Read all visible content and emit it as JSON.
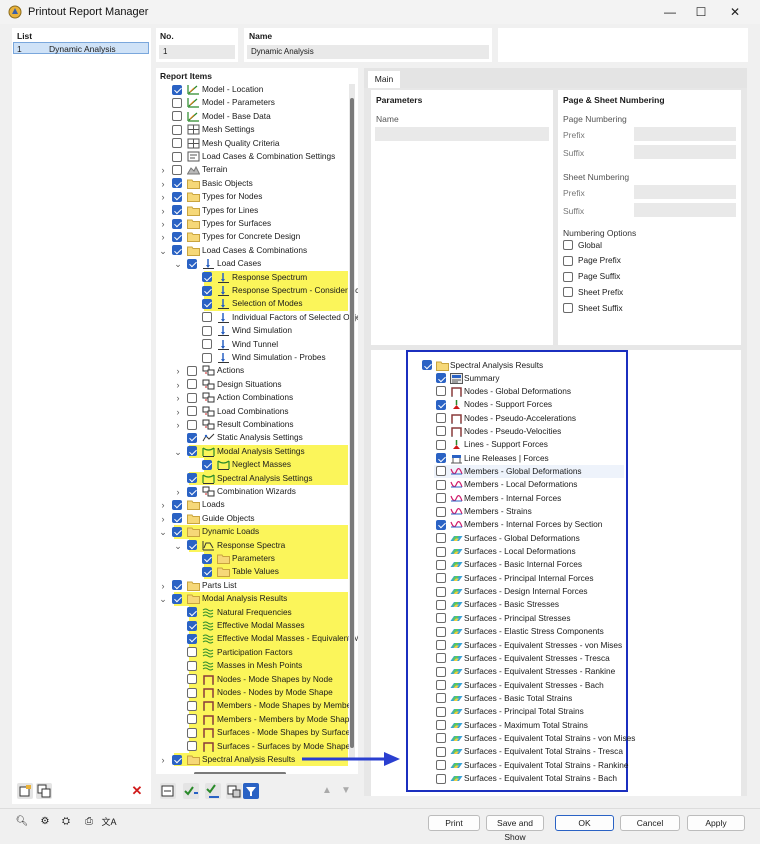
{
  "window": {
    "title": "Printout Report Manager",
    "minimize": "—",
    "maximize": "☐",
    "close": "✕"
  },
  "list": {
    "header": "List",
    "items": [
      {
        "no": "1",
        "name": "Dynamic Analysis"
      }
    ]
  },
  "no_field": {
    "label": "No.",
    "value": "1"
  },
  "name_field": {
    "label": "Name",
    "value": "Dynamic Analysis"
  },
  "report_items": {
    "header": "Report Items",
    "items": [
      {
        "label": "Model - Location",
        "level": 0,
        "checked": true,
        "expander": "",
        "icon": "model-icon",
        "highlight": false
      },
      {
        "label": "Model - Parameters",
        "level": 0,
        "checked": false,
        "expander": "",
        "icon": "model-icon",
        "highlight": false
      },
      {
        "label": "Model - Base Data",
        "level": 0,
        "checked": false,
        "expander": "",
        "icon": "model-icon",
        "highlight": false
      },
      {
        "label": "Mesh Settings",
        "level": 0,
        "checked": false,
        "expander": "",
        "icon": "mesh-icon",
        "highlight": false
      },
      {
        "label": "Mesh Quality Criteria",
        "level": 0,
        "checked": false,
        "expander": "",
        "icon": "mesh-icon",
        "highlight": false
      },
      {
        "label": "Load Cases & Combination Settings",
        "level": 0,
        "checked": false,
        "expander": "",
        "icon": "settings-icon",
        "highlight": false
      },
      {
        "label": "Terrain",
        "level": 0,
        "checked": false,
        "expander": "›",
        "icon": "terrain-icon",
        "highlight": false
      },
      {
        "label": "Basic Objects",
        "level": 0,
        "checked": true,
        "expander": "›",
        "icon": "folder-icon",
        "highlight": false
      },
      {
        "label": "Types for Nodes",
        "level": 0,
        "checked": true,
        "expander": "›",
        "icon": "folder-icon",
        "highlight": false
      },
      {
        "label": "Types for Lines",
        "level": 0,
        "checked": true,
        "expander": "›",
        "icon": "folder-icon",
        "highlight": false
      },
      {
        "label": "Types for Surfaces",
        "level": 0,
        "checked": true,
        "expander": "›",
        "icon": "folder-icon",
        "highlight": false
      },
      {
        "label": "Types for Concrete Design",
        "level": 0,
        "checked": true,
        "expander": "›",
        "icon": "folder-icon",
        "highlight": false
      },
      {
        "label": "Load Cases & Combinations",
        "level": 0,
        "checked": true,
        "expander": "⌄",
        "icon": "folder-icon",
        "highlight": false
      },
      {
        "label": "Load Cases",
        "level": 1,
        "checked": true,
        "expander": "⌄",
        "icon": "load-case-icon",
        "highlight": false
      },
      {
        "label": "Response Spectrum",
        "level": 2,
        "checked": true,
        "expander": "",
        "icon": "load-case-icon",
        "highlight": true
      },
      {
        "label": "Response Spectrum - Consider Ac",
        "level": 2,
        "checked": true,
        "expander": "",
        "icon": "load-case-icon",
        "highlight": true
      },
      {
        "label": "Selection of Modes",
        "level": 2,
        "checked": true,
        "expander": "",
        "icon": "load-case-icon",
        "highlight": true
      },
      {
        "label": "Individual Factors of Selected Obje",
        "level": 2,
        "checked": false,
        "expander": "",
        "icon": "load-case-icon",
        "highlight": false
      },
      {
        "label": "Wind Simulation",
        "level": 2,
        "checked": false,
        "expander": "",
        "icon": "load-case-icon",
        "highlight": false
      },
      {
        "label": "Wind Tunnel",
        "level": 2,
        "checked": false,
        "expander": "",
        "icon": "load-case-icon",
        "highlight": false
      },
      {
        "label": "Wind Simulation - Probes",
        "level": 2,
        "checked": false,
        "expander": "",
        "icon": "load-case-icon",
        "highlight": false
      },
      {
        "label": "Actions",
        "level": 1,
        "checked": false,
        "expander": "›",
        "icon": "action-icon",
        "highlight": false
      },
      {
        "label": "Design Situations",
        "level": 1,
        "checked": false,
        "expander": "›",
        "icon": "action-icon",
        "highlight": false
      },
      {
        "label": "Action Combinations",
        "level": 1,
        "checked": false,
        "expander": "›",
        "icon": "action-icon",
        "highlight": false
      },
      {
        "label": "Load Combinations",
        "level": 1,
        "checked": false,
        "expander": "›",
        "icon": "action-icon",
        "highlight": false
      },
      {
        "label": "Result Combinations",
        "level": 1,
        "checked": false,
        "expander": "›",
        "icon": "action-icon",
        "highlight": false
      },
      {
        "label": "Static Analysis Settings",
        "level": 1,
        "checked": true,
        "expander": "",
        "icon": "analysis-icon",
        "highlight": false
      },
      {
        "label": "Modal Analysis Settings",
        "level": 1,
        "checked": true,
        "expander": "⌄",
        "icon": "modal-icon",
        "highlight": true
      },
      {
        "label": "Neglect Masses",
        "level": 2,
        "checked": true,
        "expander": "",
        "icon": "modal-icon",
        "highlight": true
      },
      {
        "label": "Spectral Analysis Settings",
        "level": 1,
        "checked": true,
        "expander": "",
        "icon": "modal-icon",
        "highlight": true
      },
      {
        "label": "Combination Wizards",
        "level": 1,
        "checked": true,
        "expander": "›",
        "icon": "action-icon",
        "highlight": false
      },
      {
        "label": "Loads",
        "level": 0,
        "checked": true,
        "expander": "›",
        "icon": "folder-icon",
        "highlight": false
      },
      {
        "label": "Guide Objects",
        "level": 0,
        "checked": true,
        "expander": "›",
        "icon": "folder-icon",
        "highlight": false
      },
      {
        "label": "Dynamic Loads",
        "level": 0,
        "checked": true,
        "expander": "⌄",
        "icon": "folder-icon",
        "highlight": true
      },
      {
        "label": "Response Spectra",
        "level": 1,
        "checked": true,
        "expander": "⌄",
        "icon": "spectrum-icon",
        "highlight": true
      },
      {
        "label": "Parameters",
        "level": 2,
        "checked": true,
        "expander": "",
        "icon": "folder-icon",
        "highlight": true
      },
      {
        "label": "Table Values",
        "level": 2,
        "checked": true,
        "expander": "",
        "icon": "folder-icon",
        "highlight": true
      },
      {
        "label": "Parts List",
        "level": 0,
        "checked": true,
        "expander": "›",
        "icon": "folder-icon",
        "highlight": false
      },
      {
        "label": "Modal Analysis Results",
        "level": 0,
        "checked": true,
        "expander": "⌄",
        "icon": "folder-icon",
        "highlight": true
      },
      {
        "label": "Natural Frequencies",
        "level": 1,
        "checked": true,
        "expander": "",
        "icon": "wave-icon",
        "highlight": true
      },
      {
        "label": "Effective Modal Masses",
        "level": 1,
        "checked": true,
        "expander": "",
        "icon": "wave-icon",
        "highlight": true
      },
      {
        "label": "Effective Modal Masses - Equivalent M",
        "level": 1,
        "checked": true,
        "expander": "",
        "icon": "wave-icon",
        "highlight": true
      },
      {
        "label": "Participation Factors",
        "level": 1,
        "checked": false,
        "expander": "",
        "icon": "wave-icon",
        "highlight": true
      },
      {
        "label": "Masses in Mesh Points",
        "level": 1,
        "checked": false,
        "expander": "",
        "icon": "wave-icon",
        "highlight": true
      },
      {
        "label": "Nodes - Mode Shapes by Node",
        "level": 1,
        "checked": false,
        "expander": "",
        "icon": "node-icon",
        "highlight": true
      },
      {
        "label": "Nodes - Nodes by Mode Shape",
        "level": 1,
        "checked": false,
        "expander": "",
        "icon": "node-icon",
        "highlight": true
      },
      {
        "label": "Members - Mode Shapes by Member",
        "level": 1,
        "checked": false,
        "expander": "",
        "icon": "node-icon",
        "highlight": true
      },
      {
        "label": "Members - Members by Mode Shape",
        "level": 1,
        "checked": false,
        "expander": "",
        "icon": "node-icon",
        "highlight": true
      },
      {
        "label": "Surfaces - Mode Shapes by Surface",
        "level": 1,
        "checked": false,
        "expander": "",
        "icon": "node-icon",
        "highlight": true
      },
      {
        "label": "Surfaces - Surfaces by Mode Shape",
        "level": 1,
        "checked": false,
        "expander": "",
        "icon": "node-icon",
        "highlight": true
      },
      {
        "label": "Spectral Analysis Results",
        "level": 0,
        "checked": true,
        "expander": "›",
        "icon": "folder-icon",
        "highlight": true
      }
    ]
  },
  "tabs": [
    {
      "label": "Main"
    }
  ],
  "parameters": {
    "header": "Parameters",
    "name_label": "Name"
  },
  "page_sheet": {
    "header": "Page & Sheet Numbering",
    "page_numbering": "Page Numbering",
    "prefix": "Prefix",
    "suffix": "Suffix",
    "sheet_numbering": "Sheet Numbering",
    "sheet_prefix": "Prefix",
    "sheet_suffix": "Suffix",
    "options_header": "Numbering Options",
    "options": [
      {
        "label": "Global",
        "checked": false
      },
      {
        "label": "Page Prefix",
        "checked": false
      },
      {
        "label": "Page Suffix",
        "checked": false
      },
      {
        "label": "Sheet Prefix",
        "checked": false
      },
      {
        "label": "Sheet Suffix",
        "checked": false
      }
    ]
  },
  "spectral_popup": {
    "title": "Spectral Analysis Results",
    "border_color": "#1b2fbf",
    "items": [
      {
        "label": "Summary",
        "checked": true,
        "icon": "summary-icon"
      },
      {
        "label": "Nodes - Global Deformations",
        "checked": false,
        "icon": "node-icon"
      },
      {
        "label": "Nodes - Support Forces",
        "checked": true,
        "icon": "support-icon"
      },
      {
        "label": "Nodes - Pseudo-Accelerations",
        "checked": false,
        "icon": "node-icon"
      },
      {
        "label": "Nodes - Pseudo-Velocities",
        "checked": false,
        "icon": "node-icon"
      },
      {
        "label": "Lines - Support Forces",
        "checked": false,
        "icon": "support-icon"
      },
      {
        "label": "Line Releases | Forces",
        "checked": true,
        "icon": "release-icon"
      },
      {
        "label": "Members - Global Deformations",
        "checked": false,
        "icon": "member-icon"
      },
      {
        "label": "Members - Local Deformations",
        "checked": false,
        "icon": "member-icon"
      },
      {
        "label": "Members - Internal Forces",
        "checked": false,
        "icon": "member-icon"
      },
      {
        "label": "Members - Strains",
        "checked": false,
        "icon": "member-icon"
      },
      {
        "label": "Members - Internal Forces by Section",
        "checked": true,
        "icon": "member-icon"
      },
      {
        "label": "Surfaces - Global Deformations",
        "checked": false,
        "icon": "surface-icon"
      },
      {
        "label": "Surfaces - Local Deformations",
        "checked": false,
        "icon": "surface-icon"
      },
      {
        "label": "Surfaces - Basic Internal Forces",
        "checked": false,
        "icon": "surface-icon"
      },
      {
        "label": "Surfaces - Principal Internal Forces",
        "checked": false,
        "icon": "surface-icon"
      },
      {
        "label": "Surfaces - Design Internal Forces",
        "checked": false,
        "icon": "surface-icon"
      },
      {
        "label": "Surfaces - Basic Stresses",
        "checked": false,
        "icon": "surface-icon"
      },
      {
        "label": "Surfaces - Principal Stresses",
        "checked": false,
        "icon": "surface-icon"
      },
      {
        "label": "Surfaces - Elastic Stress Components",
        "checked": false,
        "icon": "surface-icon"
      },
      {
        "label": "Surfaces - Equivalent Stresses - von Mises",
        "checked": false,
        "icon": "surface-icon"
      },
      {
        "label": "Surfaces - Equivalent Stresses - Tresca",
        "checked": false,
        "icon": "surface-icon"
      },
      {
        "label": "Surfaces - Equivalent Stresses - Rankine",
        "checked": false,
        "icon": "surface-icon"
      },
      {
        "label": "Surfaces - Equivalent Stresses - Bach",
        "checked": false,
        "icon": "surface-icon"
      },
      {
        "label": "Surfaces - Basic Total Strains",
        "checked": false,
        "icon": "surface-icon"
      },
      {
        "label": "Surfaces - Principal Total Strains",
        "checked": false,
        "icon": "surface-icon"
      },
      {
        "label": "Surfaces - Maximum Total Strains",
        "checked": false,
        "icon": "surface-icon"
      },
      {
        "label": "Surfaces - Equivalent Total Strains - von Mises",
        "checked": false,
        "icon": "surface-icon"
      },
      {
        "label": "Surfaces - Equivalent Total Strains - Tresca",
        "checked": false,
        "icon": "surface-icon"
      },
      {
        "label": "Surfaces - Equivalent Total Strains - Rankine",
        "checked": false,
        "icon": "surface-icon"
      },
      {
        "label": "Surfaces - Equivalent Total Strains - Bach",
        "checked": false,
        "icon": "surface-icon"
      }
    ]
  },
  "footer": {
    "print": "Print",
    "save_and_show": "Save and Show",
    "ok": "OK",
    "cancel": "Cancel",
    "apply": "Apply"
  },
  "colors": {
    "highlight": "#fbf55a",
    "accent": "#2a62c4",
    "arrow": "#2a3fd0"
  }
}
